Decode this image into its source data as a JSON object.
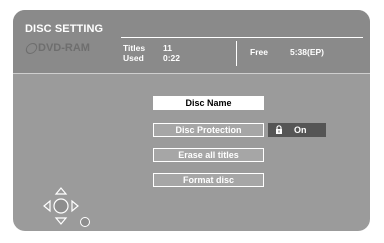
{
  "header": {
    "title": "DISC SETTING",
    "disc_type": "DVD-RAM",
    "titles_label": "Titles",
    "titles_value": "11",
    "used_label": "Used",
    "used_value": "0:22",
    "free_label": "Free",
    "free_value": "5:38(EP)"
  },
  "menu": {
    "items": [
      {
        "label": "Disc Name",
        "selected": true
      },
      {
        "label": "Disc Protection",
        "selected": false
      },
      {
        "label": "Erase all titles",
        "selected": false
      },
      {
        "label": "Format disc",
        "selected": false
      }
    ],
    "protection_status": "On"
  },
  "icons": {
    "disc": "dvd-disc-icon",
    "lock": "lock-icon",
    "navigation": "direction-pad-icon",
    "enter": "enter-button-icon"
  },
  "colors": {
    "background": "#9b9b9b",
    "header": "#8a8a8a",
    "selected_item": "#ffffff",
    "item": "#a6a6a6",
    "status_box": "#555555"
  }
}
